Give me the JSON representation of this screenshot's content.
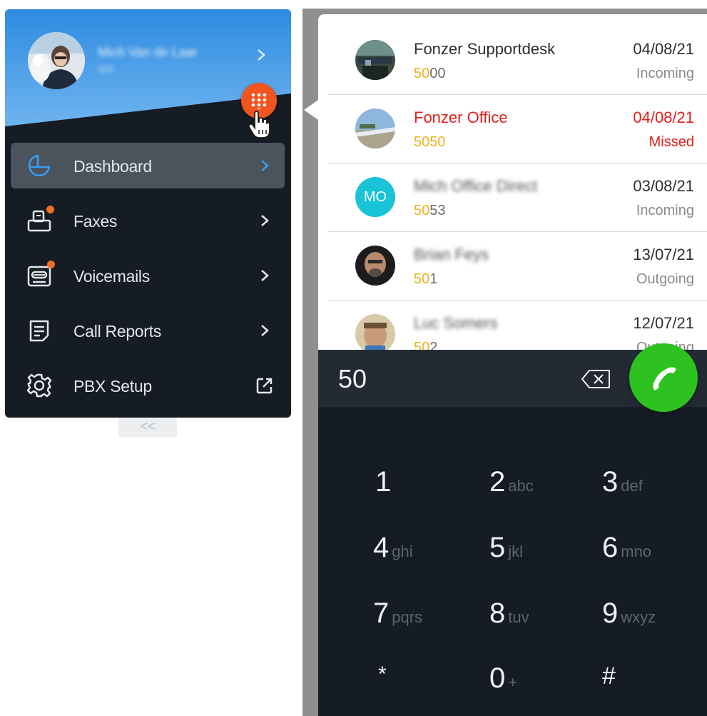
{
  "sidebar": {
    "user": {
      "name": "Mich Van de Laar",
      "extension": "503"
    },
    "collapse_label": "<<",
    "items": [
      {
        "label": "Dashboard",
        "icon": "pie-chart-icon",
        "active": true
      },
      {
        "label": "Faxes",
        "icon": "fax-icon",
        "badge": true
      },
      {
        "label": "Voicemails",
        "icon": "voicemail-icon",
        "badge": true
      },
      {
        "label": "Call Reports",
        "icon": "report-icon"
      },
      {
        "label": "PBX Setup",
        "icon": "gear-icon",
        "trailing": "external-link-icon"
      }
    ],
    "colors": {
      "header_blue": "#2f8fe0",
      "background": "#161c24",
      "active_item": "#4b535d",
      "dialpad_button": "#f0541f",
      "badge": "#f36f21"
    }
  },
  "calls": [
    {
      "name": "Fonzer Supportdesk",
      "number_match": "50",
      "number_rest": "00",
      "date": "04/08/21",
      "type": "Incoming",
      "missed": false
    },
    {
      "name": "Fonzer Office",
      "number_match": "5050",
      "number_rest": "",
      "date": "04/08/21",
      "type": "Missed",
      "missed": true
    },
    {
      "name": "Mich Office Direct",
      "initials": "MO",
      "number_match": "50",
      "number_rest": "53",
      "date": "03/08/21",
      "type": "Incoming",
      "missed": false
    },
    {
      "name": "Brian Feys",
      "number_match": "50",
      "number_rest": "1",
      "date": "13/07/21",
      "type": "Outgoing",
      "missed": false
    },
    {
      "name": "Luc Somers",
      "number_match": "50",
      "number_rest": "2",
      "date": "12/07/21",
      "type": "Outgoing",
      "missed": false
    }
  ],
  "dialer": {
    "input_value": "50",
    "keys": [
      {
        "digit": "1",
        "letters": ""
      },
      {
        "digit": "2",
        "letters": "abc"
      },
      {
        "digit": "3",
        "letters": "def"
      },
      {
        "digit": "4",
        "letters": "ghi"
      },
      {
        "digit": "5",
        "letters": "jkl"
      },
      {
        "digit": "6",
        "letters": "mno"
      },
      {
        "digit": "7",
        "letters": "pqrs"
      },
      {
        "digit": "8",
        "letters": "tuv"
      },
      {
        "digit": "9",
        "letters": "wxyz"
      },
      {
        "digit": "*",
        "letters": ""
      },
      {
        "digit": "0",
        "letters": "+"
      },
      {
        "digit": "#",
        "letters": ""
      }
    ],
    "colors": {
      "call_button": "#2dc21f",
      "number_highlight": "#f2b01e",
      "missed": "#e3201b"
    }
  }
}
